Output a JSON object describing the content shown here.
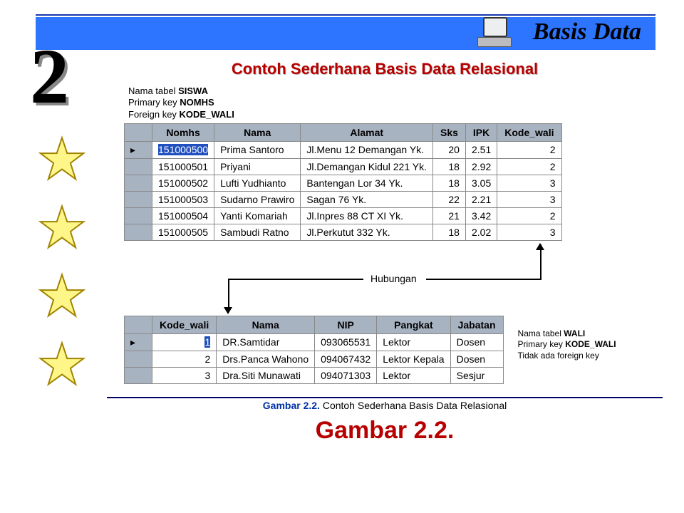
{
  "header": {
    "label": "Basis Data"
  },
  "chapter_number": "2",
  "title": "Contoh Sederhana Basis Data Relasional",
  "siswa_meta": {
    "line1_prefix": "Nama tabel ",
    "line1_bold": "SISWA",
    "line2_prefix": "Primary key ",
    "line2_bold": "NOMHS",
    "line3_prefix": "Foreign key ",
    "line3_bold": "KODE_WALI"
  },
  "siswa_table": {
    "columns": [
      "Nomhs",
      "Nama",
      "Alamat",
      "Sks",
      "IPK",
      "Kode_wali"
    ],
    "rows": [
      [
        "151000500",
        "Prima Santoro",
        "Jl.Menu 12 Demangan Yk.",
        "20",
        "2.51",
        "2"
      ],
      [
        "151000501",
        "Priyani",
        "Jl.Demangan Kidul 221 Yk.",
        "18",
        "2.92",
        "2"
      ],
      [
        "151000502",
        "Lufti Yudhianto",
        "Bantengan Lor 34 Yk.",
        "18",
        "3.05",
        "3"
      ],
      [
        "151000503",
        "Sudarno Prawiro",
        "Sagan 76 Yk.",
        "22",
        "2.21",
        "3"
      ],
      [
        "151000504",
        "Yanti Komariah",
        "Jl.Inpres 88 CT XI Yk.",
        "21",
        "3.42",
        "2"
      ],
      [
        "151000505",
        "Sambudi Ratno",
        "Jl.Perkutut 332 Yk.",
        "18",
        "2.02",
        "3"
      ]
    ]
  },
  "relation_label": "Hubungan",
  "wali_meta": {
    "line1_prefix": "Nama tabel ",
    "line1_bold": "WALI",
    "line2_prefix": "Primary key ",
    "line2_bold": "KODE_WALI",
    "line3": "Tidak ada foreign key"
  },
  "wali_table": {
    "columns": [
      "Kode_wali",
      "Nama",
      "NIP",
      "Pangkat",
      "Jabatan"
    ],
    "rows": [
      [
        "1",
        "DR.Samtidar",
        "093065531",
        "Lektor",
        "Dosen"
      ],
      [
        "2",
        "Drs.Panca Wahono",
        "094067432",
        "Lektor Kepala",
        "Dosen"
      ],
      [
        "3",
        "Dra.Siti Munawati",
        "094071303",
        "Lektor",
        "Sesjur"
      ]
    ]
  },
  "figure_caption": {
    "bold": "Gambar 2.2.",
    "rest": " Contoh Sederhana Basis Data Relasional"
  },
  "big_caption": "Gambar 2.2."
}
